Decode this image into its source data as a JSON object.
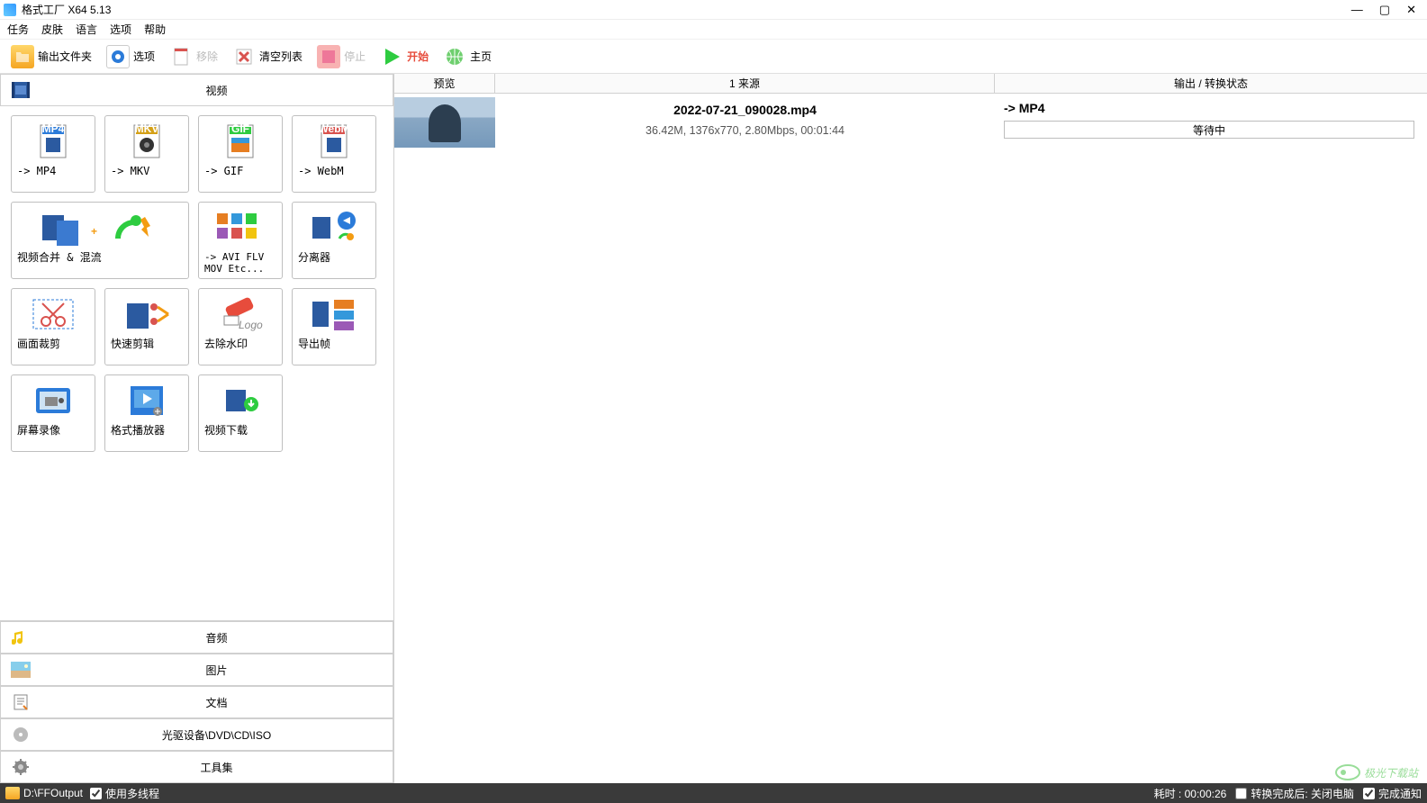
{
  "window": {
    "title": "格式工厂 X64 5.13"
  },
  "menu": {
    "task": "任务",
    "skin": "皮肤",
    "lang": "语言",
    "options": "选项",
    "help": "帮助"
  },
  "toolbar": {
    "output_folder": "输出文件夹",
    "options": "选项",
    "remove": "移除",
    "clear": "清空列表",
    "stop": "停止",
    "start": "开始",
    "home": "主页"
  },
  "categories": {
    "video": "视频",
    "audio": "音频",
    "picture": "图片",
    "document": "文档",
    "disc": "光驱设备\\DVD\\CD\\ISO",
    "tools": "工具集"
  },
  "tiles": {
    "mp4": "-> MP4",
    "mkv": "-> MKV",
    "gif": "-> GIF",
    "webm": "-> WebM",
    "merge": "视频合并 & 混流",
    "avi_etc": "-> AVI FLV MOV Etc...",
    "splitter": "分离器",
    "crop": "画面裁剪",
    "quick_cut": "快速剪辑",
    "remove_wm": "去除水印",
    "export_frames": "导出帧",
    "screen_rec": "屏幕录像",
    "player": "格式播放器",
    "video_dl": "视频下载"
  },
  "columns": {
    "preview": "预览",
    "source_prefix": "1 来源",
    "output": "输出 / 转换状态"
  },
  "task": {
    "filename": "2022-07-21_090028.mp4",
    "meta": "36.42M, 1376x770, 2.80Mbps, 00:01:44",
    "target": "-> MP4",
    "status": "等待中"
  },
  "statusbar": {
    "path": "D:\\FFOutput",
    "multithread": "使用多线程",
    "elapsed": "耗时 : 00:00:26",
    "after_done": "转换完成后: 关闭电脑",
    "notify": "完成通知"
  },
  "watermark": "极光下载站"
}
